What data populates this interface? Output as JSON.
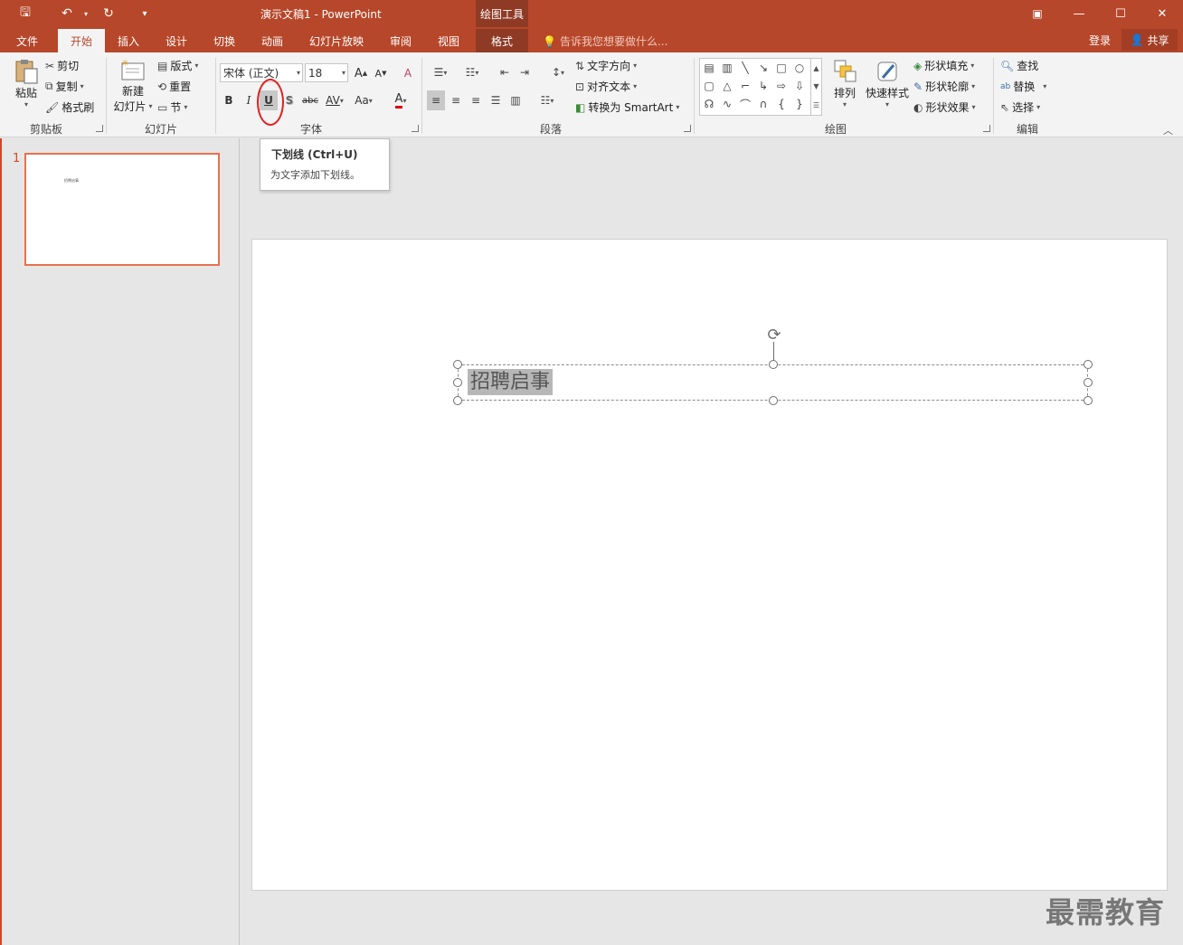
{
  "window": {
    "title": "演示文稿1 - PowerPoint",
    "context_header": "绘图工具",
    "controls": {
      "restore_ribbon": "▣",
      "minimize": "—",
      "maximize": "☐",
      "close": "✕"
    }
  },
  "qat": {
    "save": "🖫",
    "undo": "↶",
    "redo": "↻",
    "customize": "▾"
  },
  "tabs": [
    {
      "label": "文件"
    },
    {
      "label": "开始"
    },
    {
      "label": "插入"
    },
    {
      "label": "设计"
    },
    {
      "label": "切换"
    },
    {
      "label": "动画"
    },
    {
      "label": "幻灯片放映"
    },
    {
      "label": "审阅"
    },
    {
      "label": "视图"
    },
    {
      "label": "格式"
    }
  ],
  "tell_me": {
    "placeholder": "告诉我您想要做什么..."
  },
  "account": {
    "signin": "登录",
    "share": "共享"
  },
  "ribbon": {
    "clipboard": {
      "paste": "粘贴",
      "cut": "剪切",
      "copy": "复制",
      "format_painter": "格式刷",
      "label": "剪贴板"
    },
    "slides": {
      "new_slide_line1": "新建",
      "new_slide_line2": "幻灯片",
      "layout": "版式",
      "reset": "重置",
      "section": "节",
      "label": "幻灯片"
    },
    "font": {
      "font_name": "宋体 (正文)",
      "font_size": "18",
      "grow": "A",
      "shrink": "A",
      "clear": "A",
      "bold": "B",
      "italic": "I",
      "underline": "U",
      "shadow": "S",
      "strike": "abc",
      "spacing": "AV",
      "case": "Aa",
      "color": "A",
      "label": "字体"
    },
    "paragraph": {
      "text_direction": "文字方向",
      "align_text": "对齐文本",
      "smartart": "转换为 SmartArt",
      "label": "段落"
    },
    "drawing": {
      "arrange": "排列",
      "quick_styles": "快速样式",
      "shape_fill": "形状填充",
      "shape_outline": "形状轮廓",
      "shape_effects": "形状效果",
      "label": "绘图"
    },
    "editing": {
      "find": "查找",
      "replace": "替换",
      "select": "选择",
      "label": "编辑"
    }
  },
  "tooltip": {
    "title": "下划线 (Ctrl+U)",
    "description": "为文字添加下划线。"
  },
  "slides_pane": {
    "number": "1",
    "thumb_text": "招聘启事"
  },
  "slide": {
    "text": "招聘启事"
  },
  "watermark": "最需教育",
  "colors": {
    "accent": "#b7472a",
    "context": "#8f3a24",
    "highlight": "#e02020"
  }
}
